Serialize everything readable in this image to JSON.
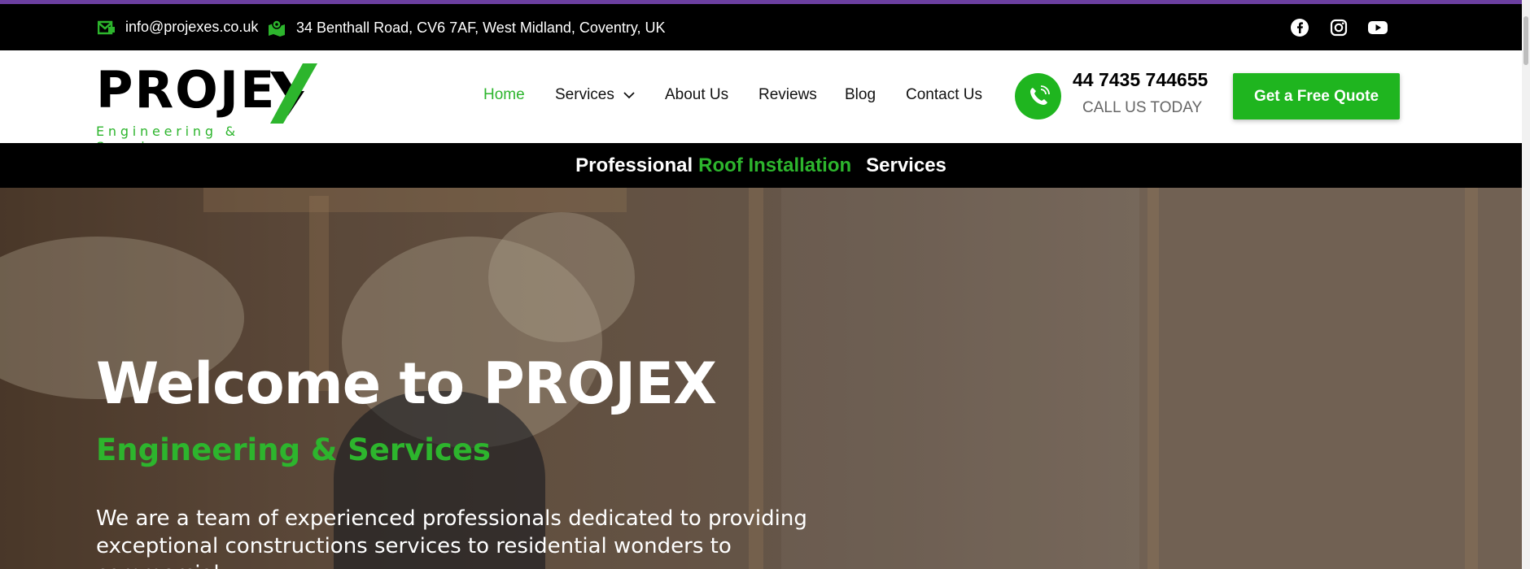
{
  "topbar": {
    "email": "info@projexes.co.uk",
    "address": "34 Benthall Road, CV6 7AF, West Midland, Coventry, UK",
    "social_icons": [
      "facebook-icon",
      "instagram-icon",
      "youtube-icon"
    ]
  },
  "logo": {
    "word": "PROJE",
    "subtitle": "Engineering & Services"
  },
  "nav": {
    "items": [
      "Home",
      "Services",
      "About Us",
      "Reviews",
      "Blog",
      "Contact Us"
    ],
    "active": "Home"
  },
  "contact": {
    "phone": "44 7435 744655",
    "tagline": "CALL US TODAY"
  },
  "cta": {
    "label": "Get a Free Quote"
  },
  "banner": {
    "prefix": "Professional",
    "highlight": "Roof Installation",
    "suffix": "Services"
  },
  "hero": {
    "title": "Welcome to PROJEX",
    "subtitle": "Engineering & Services",
    "body": "We are a team of experienced professionals dedicated to providing exceptional constructions services to residential wonders to commercial"
  },
  "colors": {
    "brand_green": "#1fb51f",
    "accent_purple": "#6b3fa0",
    "topbar_bg": "#000000"
  }
}
